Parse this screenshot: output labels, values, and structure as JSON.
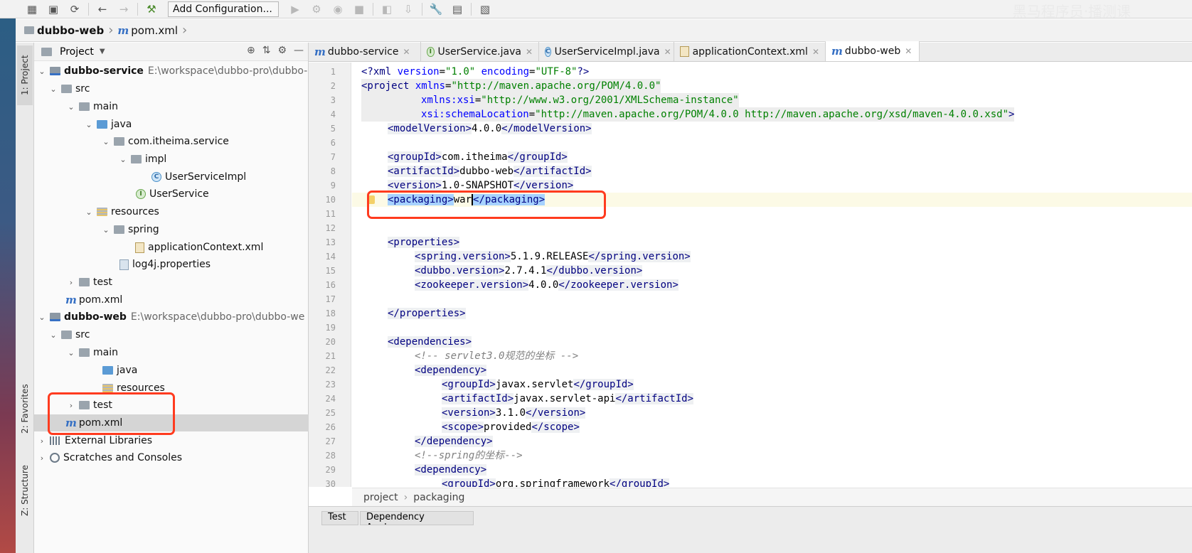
{
  "toolbar": {
    "run_config": "Add Configuration...",
    "watermark": "黑马程序员·播测课"
  },
  "navbar": {
    "project": "dubbo-web",
    "file": "pom.xml"
  },
  "side_tabs": {
    "project": "1: Project",
    "favorites": "2: Favorites",
    "structure": "Z: Structure"
  },
  "project_panel": {
    "title": "Project",
    "tree": [
      {
        "label": "dubbo-service",
        "path": "E:\\workspace\\dubbo-pro\\dubbo-",
        "bold": true
      },
      {
        "label": "src"
      },
      {
        "label": "main"
      },
      {
        "label": "java"
      },
      {
        "label": "com.itheima.service"
      },
      {
        "label": "impl"
      },
      {
        "label": "UserServiceImpl"
      },
      {
        "label": "UserService"
      },
      {
        "label": "resources"
      },
      {
        "label": "spring"
      },
      {
        "label": "applicationContext.xml"
      },
      {
        "label": "log4j.properties"
      },
      {
        "label": "test"
      },
      {
        "label": "pom.xml"
      },
      {
        "label": "dubbo-web",
        "path": "E:\\workspace\\dubbo-pro\\dubbo-we",
        "bold": true
      },
      {
        "label": "src"
      },
      {
        "label": "main"
      },
      {
        "label": "java"
      },
      {
        "label": "resources"
      },
      {
        "label": "test"
      },
      {
        "label": "pom.xml"
      },
      {
        "label": "External Libraries"
      },
      {
        "label": "Scratches and Consoles"
      }
    ]
  },
  "tabs": [
    {
      "label": "dubbo-service"
    },
    {
      "label": "UserService.java"
    },
    {
      "label": "UserServiceImpl.java"
    },
    {
      "label": "applicationContext.xml"
    },
    {
      "label": "dubbo-web"
    }
  ],
  "editor": {
    "line_numbers": [
      "1",
      "2",
      "3",
      "4",
      "5",
      "6",
      "7",
      "8",
      "9",
      "10",
      "11",
      "12",
      "13",
      "14",
      "15",
      "16",
      "17",
      "18",
      "19",
      "20",
      "21",
      "22",
      "23",
      "24",
      "25",
      "26",
      "27",
      "28",
      "29",
      "30"
    ],
    "lines": {
      "l1_a": "<?xml ",
      "l1_b": "version",
      "l1_c": "=",
      "l1_d": "\"1.0\"",
      "l1_e": " encoding",
      "l1_f": "=",
      "l1_g": "\"UTF-8\"",
      "l1_h": "?>",
      "l2_a": "<project ",
      "l2_b": "xmlns",
      "l2_c": "=",
      "l2_d": "\"http://maven.apache.org/POM/4.0.0\"",
      "l3_b": "xmlns:xsi",
      "l3_c": "=",
      "l3_d": "\"http://www.w3.org/2001/XMLSchema-instance\"",
      "l4_b": "xsi:schemaLocation",
      "l4_c": "=",
      "l4_d": "\"http://maven.apache.org/POM/4.0.0 http://maven.apache.org/xsd/maven-4.0.0.xsd\"",
      "l4_e": ">",
      "l5_a": "<modelVersion>",
      "l5_b": "4.0.0",
      "l5_c": "</modelVersion>",
      "l7_a": "<groupId>",
      "l7_b": "com.itheima",
      "l7_c": "</groupId>",
      "l8_a": "<artifactId>",
      "l8_b": "dubbo-web",
      "l8_c": "</artifactId>",
      "l9_a": "<version>",
      "l9_b": "1.0-SNAPSHOT",
      "l9_c": "</version>",
      "l10_a": "<packaging>",
      "l10_b": "war",
      "l10_c": "</packaging>",
      "l13_a": "<properties>",
      "l14_a": "<spring.version>",
      "l14_b": "5.1.9.RELEASE",
      "l14_c": "</spring.version>",
      "l15_a": "<dubbo.version>",
      "l15_b": "2.7.4.1",
      "l15_c": "</dubbo.version>",
      "l16_a": "<zookeeper.version>",
      "l16_b": "4.0.0",
      "l16_c": "</zookeeper.version>",
      "l18_a": "</properties>",
      "l20_a": "<dependencies>",
      "l21_a": "<!-- servlet3.0规范的坐标 -->",
      "l22_a": "<dependency>",
      "l23_a": "<groupId>",
      "l23_b": "javax.servlet",
      "l23_c": "</groupId>",
      "l24_a": "<artifactId>",
      "l24_b": "javax.servlet-api",
      "l24_c": "</artifactId>",
      "l25_a": "<version>",
      "l25_b": "3.1.0",
      "l25_c": "</version>",
      "l26_a": "<scope>",
      "l26_b": "provided",
      "l26_c": "</scope>",
      "l27_a": "</dependency>",
      "l28_a": "<!--spring的坐标-->",
      "l29_a": "<dependency>",
      "l30_a": "<groupId>",
      "l30_b": "org.springframework",
      "l30_c": "</groupId>"
    }
  },
  "breadcrumb": {
    "a": "project",
    "b": "packaging"
  },
  "bottom_tabs": {
    "a": "Test",
    "b": "Dependency Analyzer"
  }
}
